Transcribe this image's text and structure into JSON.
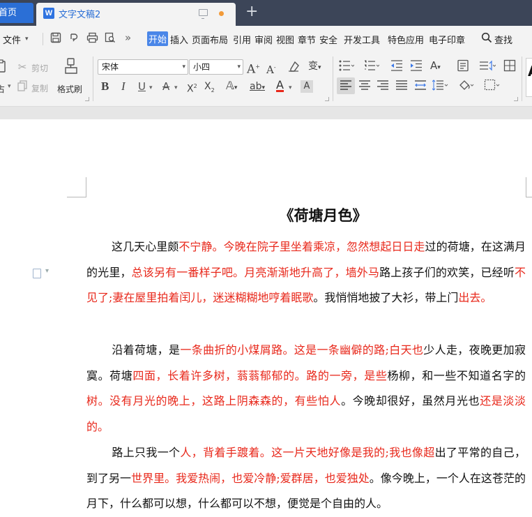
{
  "tabs": {
    "home_label": "首页",
    "doc_title": "文字文稿2",
    "doc_logo": "W",
    "new_tab": "+"
  },
  "menubar": {
    "file_label": "文件",
    "more_glyph": "»",
    "items": [
      "开始",
      "插入",
      "页面布局",
      "引用",
      "审阅",
      "视图",
      "章节",
      "安全",
      "开发工具",
      "特色应用",
      "电子印章"
    ],
    "active_item": "开始",
    "search_label": "查找"
  },
  "ribbon": {
    "cut_label": "剪切",
    "copy_label": "复制",
    "paste_label": "占",
    "format_painter_label": "格式刷",
    "font_name": "宋体",
    "font_size": "小四",
    "bold": "B",
    "italic": "I",
    "underline": "U",
    "style_preview": "A"
  },
  "document": {
    "title": "《荷塘月色》",
    "paragraphs": [
      [
        {
          "t": "这几天心里颇",
          "red": false
        },
        {
          "t": "不宁静。今晚在院子里坐着乘凉，忽然想起日日走",
          "red": true
        },
        {
          "t": "过的荷塘，在这满月的光里，",
          "red": false
        },
        {
          "t": "总该另有一番样子吧。月亮渐渐地升高了，墙外马",
          "red": true
        },
        {
          "t": "路上孩子们的欢笑，已经听",
          "red": false
        },
        {
          "t": "不见了;妻在屋里拍着闰儿，迷迷糊糊地哼着眠歌",
          "red": true
        },
        {
          "t": "。我悄悄地披了大衫，带上门",
          "red": false
        },
        {
          "t": "出去。",
          "red": true
        }
      ],
      [
        {
          "t": "沿着荷塘，是",
          "red": false
        },
        {
          "t": "一条曲折的小煤屑路。这是一条幽僻的路;白天也",
          "red": true
        },
        {
          "t": "少人走，夜晚更加寂寞。荷塘",
          "red": false
        },
        {
          "t": "四面，长着许多树，蓊蓊郁郁的。路的一旁，是些",
          "red": true
        },
        {
          "t": "杨柳，和一些不知道名字的",
          "red": false
        },
        {
          "t": "树。没有月光的晚上，这路上阴森森的，有些怕人",
          "red": true
        },
        {
          "t": "。今晚却很好，虽然月光也",
          "red": false
        },
        {
          "t": "还是淡淡的。",
          "red": true
        }
      ],
      [
        {
          "t": "路上只我一个",
          "red": false
        },
        {
          "t": "人，背着手踱着。这一片天地好像是我的;我也像超",
          "red": true
        },
        {
          "t": "出了平常的自己，到了另一",
          "red": false
        },
        {
          "t": "世界里。我爱热闹，也爱冷静;爱群居，也爱独处",
          "red": true
        },
        {
          "t": "。像今晚上，一个人在这苍茫的月下，什么都可以想，什么都可以不想，便觉是个自由的人。",
          "red": false
        }
      ]
    ]
  },
  "colors": {
    "tabbar_bg": "#3c4558",
    "accent_blue": "#2b6fd6",
    "ribbon_bg": "#f3f3f3",
    "highlight_red": "#e8281b"
  }
}
